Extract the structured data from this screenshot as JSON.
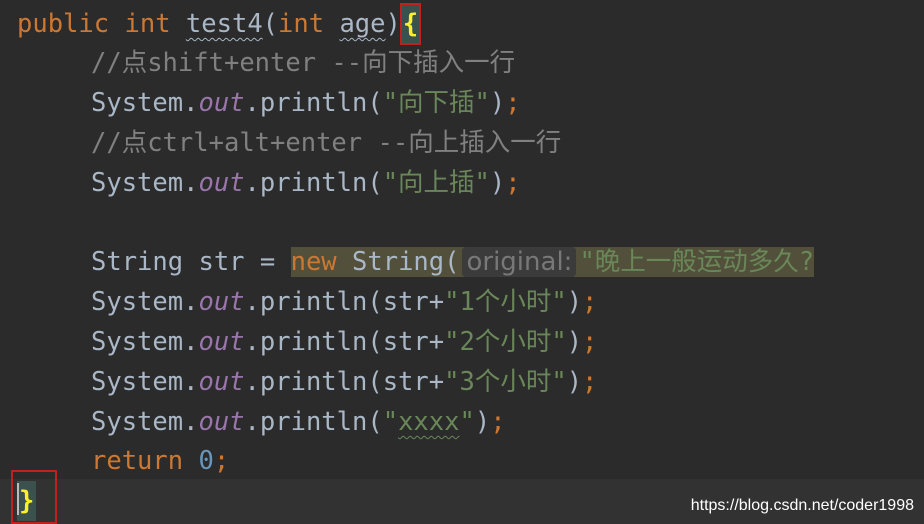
{
  "code": {
    "line1": {
      "public": "public",
      "int": "int",
      "method_name": "test4",
      "open_paren": "(",
      "param_type": "int",
      "param_name": "age",
      "close_paren": ")",
      "open_brace": "{"
    },
    "line2": {
      "comment": "//点shift+enter --向下插入一行"
    },
    "line3": {
      "system": "System.",
      "out": "out",
      "println": ".println(",
      "string": "\"向下插\"",
      "end": ")",
      "semi": ";"
    },
    "line4": {
      "comment": "//点ctrl+alt+enter --向上插入一行"
    },
    "line5": {
      "system": "System.",
      "out": "out",
      "println": ".println(",
      "string": "\"向上插\"",
      "end": ")",
      "semi": ";"
    },
    "line7": {
      "decl": "String str = ",
      "new": "new",
      "ctor": " String(",
      "param_hint": "original:",
      "string": "\"晚上一般运动多久?"
    },
    "line8": {
      "system": "System.",
      "out": "out",
      "println": ".println(str+",
      "string": "\"1个小时\"",
      "end": ")",
      "semi": ";"
    },
    "line9": {
      "system": "System.",
      "out": "out",
      "println": ".println(str+",
      "string": "\"2个小时\"",
      "end": ")",
      "semi": ";"
    },
    "line10": {
      "system": "System.",
      "out": "out",
      "println": ".println(str+",
      "string": "\"3个小时\"",
      "end": ")",
      "semi": ";"
    },
    "line11": {
      "system": "System.",
      "out": "out",
      "println": ".println(",
      "quote_open": "\"",
      "string_body": "xxxx",
      "quote_close": "\"",
      "end": ")",
      "semi": ";"
    },
    "line12": {
      "return": "return",
      "value": "0",
      "semi": ";"
    },
    "line13": {
      "close_brace": "}"
    }
  },
  "watermark": "https://blog.csdn.net/coder1998",
  "colors": {
    "background": "#2b2b2b",
    "keyword": "#cc7832",
    "string": "#6a8759",
    "static_field": "#9876aa",
    "comment": "#808080",
    "number": "#6897bb",
    "brace_match": "#ffef28",
    "annotation_box": "#c0201e"
  }
}
